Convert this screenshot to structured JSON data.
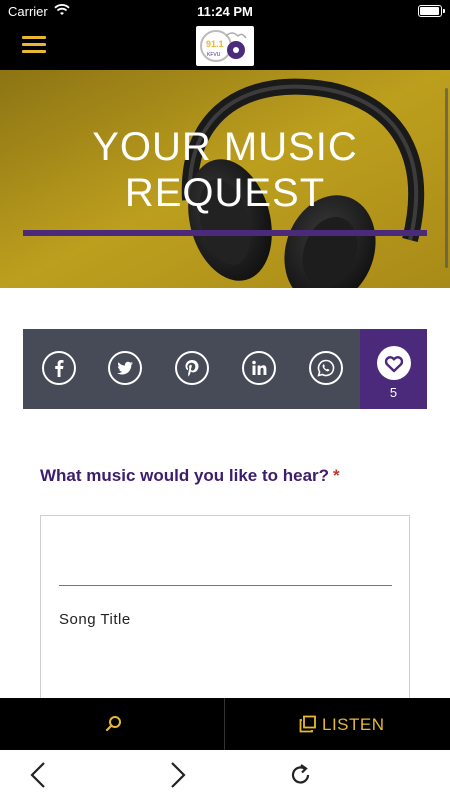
{
  "status_bar": {
    "carrier": "Carrier",
    "time": "11:24 PM"
  },
  "header": {
    "menu_icon": "hamburger-menu-icon",
    "logo_text": "91.1",
    "logo_subtext": "KFVU"
  },
  "hero": {
    "title_line1": "YOUR MUSIC",
    "title_line2": "REQUEST"
  },
  "share": {
    "icons": [
      "facebook-icon",
      "twitter-icon",
      "pinterest-icon",
      "linkedin-icon",
      "whatsapp-icon"
    ],
    "like_icon": "heart-icon",
    "like_count": "5"
  },
  "form": {
    "question": "What music would you like to hear?",
    "required_mark": "*",
    "song_value": "",
    "song_label": "Song Title"
  },
  "bottom_bar": {
    "search_icon": "search-icon",
    "listen_label": "LISTEN",
    "listen_icon": "copy-icon"
  },
  "browser_nav": {
    "back_icon": "chevron-left-icon",
    "forward_icon": "chevron-right-icon",
    "reload_icon": "reload-icon"
  },
  "colors": {
    "accent_gold": "#e8b830",
    "brand_purple": "#4b2a7c",
    "share_bar": "#474b57",
    "question_text": "#3c1d6e"
  }
}
